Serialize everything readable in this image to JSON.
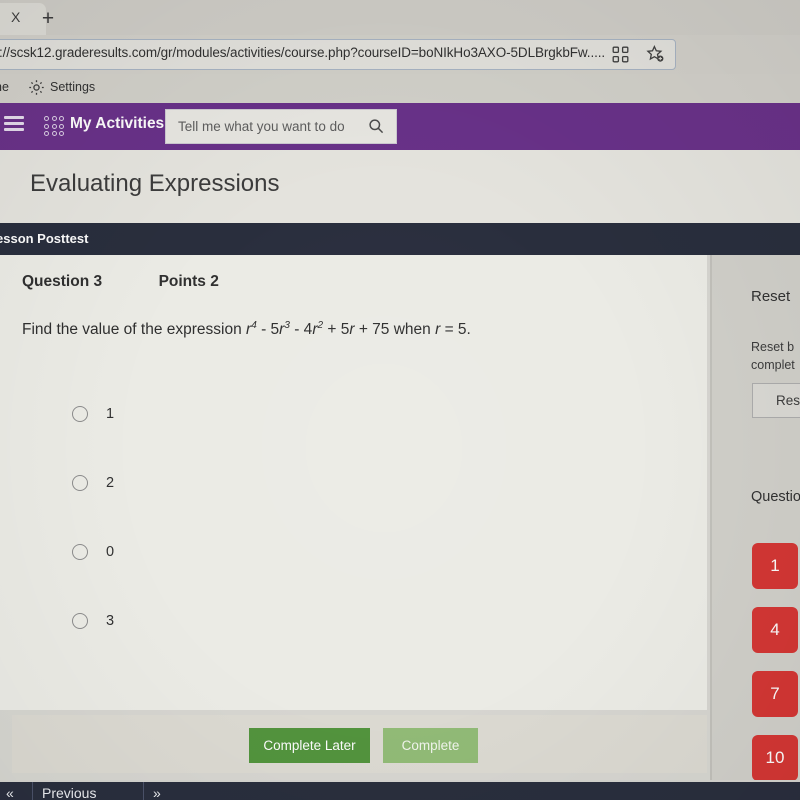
{
  "browser": {
    "tab_close_label": "X",
    "new_tab_label": "+",
    "url": "://scsk12.graderesults.com/gr/modules/activities/course.php?courseID=boNIkHo3AXO-5DLBrgkbFw.....",
    "qr_icon": "qr-code-icon",
    "favorite_icon": "star-favorite-icon",
    "collections_icon": "collections-icon",
    "bookmarks": {
      "home_label": "ne",
      "gear_icon": "gear-icon",
      "settings_label": "Settings"
    }
  },
  "appnav": {
    "menu_icon": "hamburger-menu-icon",
    "grid_icon": "app-grid-icon",
    "title": "My Activities",
    "search_placeholder": "Tell me what you want to do",
    "search_icon": "search-icon",
    "accent_color": "#6b2d8e"
  },
  "page": {
    "title": "Evaluating Expressions",
    "subbar_label": "esson Posttest",
    "subbar_color": "#262b3c"
  },
  "question": {
    "number_label": "Question 3",
    "points_label": "Points 2",
    "prompt_prefix": "Find the value of the expression ",
    "expr": {
      "v1": "r",
      "e1": "4",
      "op1": " - 5",
      "v2": "r",
      "e2": "3",
      "op2": " - 4",
      "v3": "r",
      "e3": "2",
      "op3": " + 5",
      "v4": "r",
      "op4": " + 75"
    },
    "prompt_when": " when ",
    "prompt_var": "r",
    "prompt_value": " = 5.",
    "options": [
      {
        "label": "1",
        "selected": false
      },
      {
        "label": "2",
        "selected": false
      },
      {
        "label": "0",
        "selected": false
      },
      {
        "label": "3",
        "selected": false
      }
    ]
  },
  "actions": {
    "complete_later_label": "Complete Later",
    "complete_label": "Complete",
    "complete_later_color": "#4d9535",
    "complete_color": "#8fbd71"
  },
  "sidebar": {
    "reset_title": "Reset",
    "reset_description": "Reset b complet",
    "reset_button_label": "Res",
    "questions_label": "Questio",
    "question_buttons": [
      {
        "label": "1"
      },
      {
        "label": "4"
      },
      {
        "label": "7"
      },
      {
        "label": "10"
      }
    ],
    "question_button_color": "#e0312e"
  },
  "bottom_nav": {
    "first_label": "«",
    "previous_label": "Previous",
    "next_label": "»"
  }
}
